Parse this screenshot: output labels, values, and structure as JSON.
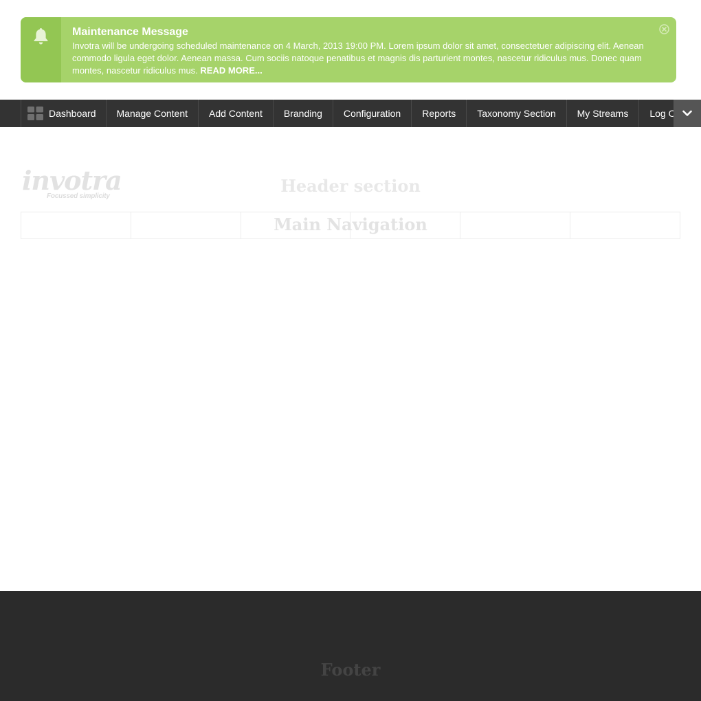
{
  "alert": {
    "title": "Maintenance Message",
    "body": "Invotra will be undergoing scheduled maintenance on 4 March, 2013 19:00 PM. Lorem ipsum dolor sit amet, consectetuer adipiscing elit. Aenean commodo ligula eget dolor. Aenean massa. Cum sociis natoque penatibus et magnis dis parturient montes, nascetur ridiculus mus. Donec quam montes, nascetur ridiculus mus.",
    "read_more": "READ MORE...",
    "icon": "bell-icon",
    "close_icon": "close-icon",
    "colors": {
      "background": "#a6d36a",
      "icon_column": "#93c653"
    }
  },
  "toolbar": {
    "items": [
      {
        "label": "Dashboard",
        "icon": "dashboard-grid-icon"
      },
      {
        "label": "Manage Content"
      },
      {
        "label": "Add Content"
      },
      {
        "label": "Branding"
      },
      {
        "label": "Configuration"
      },
      {
        "label": "Reports"
      },
      {
        "label": "Taxonomy Section"
      },
      {
        "label": "My Streams"
      },
      {
        "label": "Log Out",
        "icon": "power-icon"
      }
    ],
    "more_icon": "chevron-down-icon",
    "colors": {
      "background": "#333333",
      "accent": "#8cc63f"
    }
  },
  "header": {
    "logo_text": "invotra",
    "logo_tagline": "Focussed simplicity",
    "section_label": "Header section",
    "nav_label": "Main Navigation",
    "nav_cells": 6
  },
  "footer": {
    "label": "Footer",
    "colors": {
      "background": "#2b2b2b"
    }
  }
}
